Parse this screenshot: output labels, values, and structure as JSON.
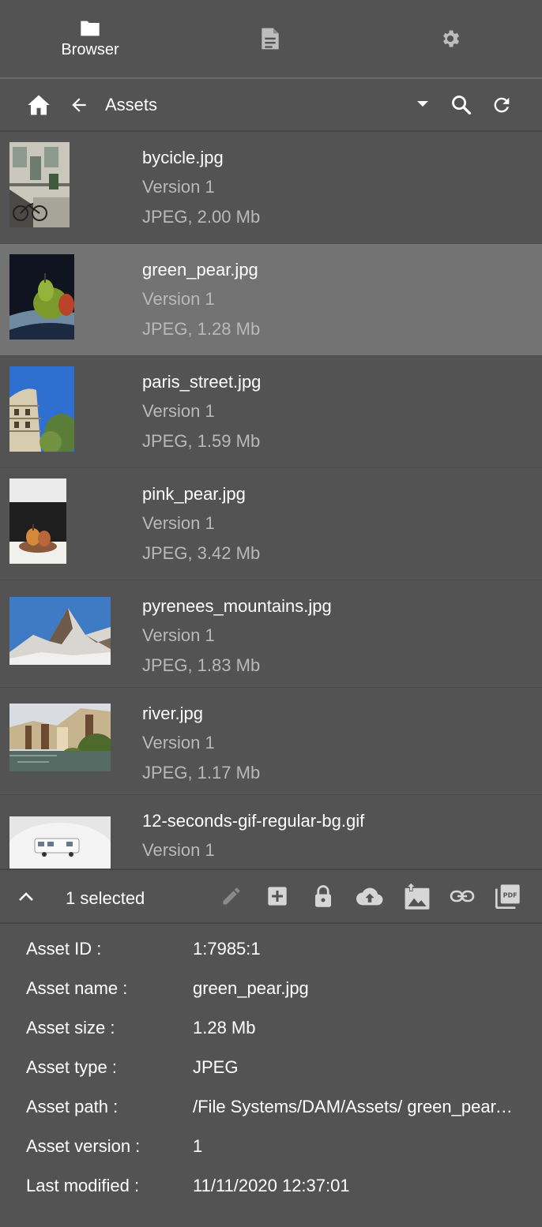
{
  "topbar": {
    "tabs": [
      {
        "icon": "folder-icon",
        "label": "Browser",
        "active": true
      },
      {
        "icon": "document-icon",
        "label": "",
        "active": false
      },
      {
        "icon": "gear-icon",
        "label": "",
        "active": false
      }
    ]
  },
  "navbar": {
    "home_icon": "home-icon",
    "back_icon": "arrow-left-icon",
    "folder_name": "Assets",
    "dropdown_icon": "caret-down-icon",
    "search_icon": "search-icon",
    "refresh_icon": "refresh-icon"
  },
  "assets": [
    {
      "name": "bycicle.jpg",
      "version": "Version 1",
      "meta": "JPEG, 2.00 Mb",
      "selected": false
    },
    {
      "name": "green_pear.jpg",
      "version": "Version 1",
      "meta": "JPEG, 1.28 Mb",
      "selected": true
    },
    {
      "name": "paris_street.jpg",
      "version": "Version 1",
      "meta": "JPEG, 1.59 Mb",
      "selected": false
    },
    {
      "name": "pink_pear.jpg",
      "version": "Version 1",
      "meta": "JPEG, 3.42 Mb",
      "selected": false
    },
    {
      "name": "pyrenees_mountains.jpg",
      "version": "Version 1",
      "meta": "JPEG, 1.83 Mb",
      "selected": false
    },
    {
      "name": "river.jpg",
      "version": "Version 1",
      "meta": "JPEG, 1.17 Mb",
      "selected": false
    },
    {
      "name": "12-seconds-gif-regular-bg.gif",
      "version": "Version 1",
      "meta": "",
      "selected": false
    }
  ],
  "actionbar": {
    "selected_label": "1 selected",
    "icons": [
      "chevron-up-icon",
      "edit-icon",
      "add-icon",
      "lock-icon",
      "cloud-upload-icon",
      "image-upload-icon",
      "link-icon",
      "pdf-icon"
    ]
  },
  "details": [
    {
      "key": "Asset ID :",
      "value": "1:7985:1"
    },
    {
      "key": "Asset name :",
      "value": "green_pear.jpg"
    },
    {
      "key": "Asset size :",
      "value": "1.28 Mb"
    },
    {
      "key": "Asset type :",
      "value": "JPEG"
    },
    {
      "key": "Asset path :",
      "value": "/File Systems/DAM/Assets/ green_pear.jpg"
    },
    {
      "key": "Asset version :",
      "value": "1"
    },
    {
      "key": "Last modified :",
      "value": "11/11/2020 12:37:01"
    }
  ],
  "colors": {
    "background": "#535353",
    "selected_row": "#737373",
    "secondary_text": "#b9b9b9"
  }
}
